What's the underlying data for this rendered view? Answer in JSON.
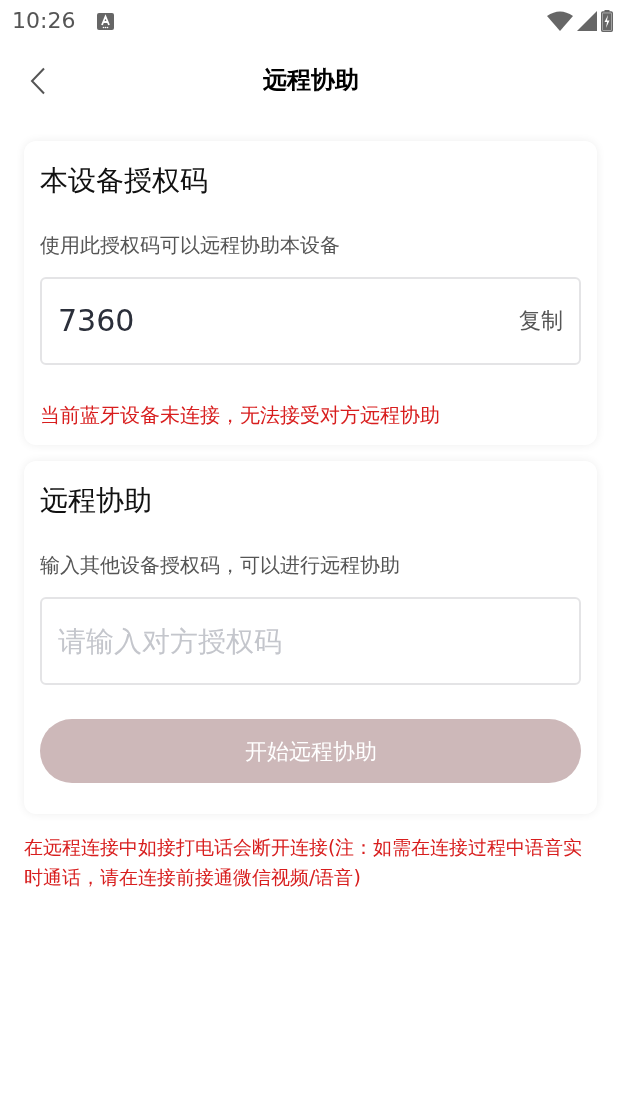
{
  "status_bar": {
    "time": "10:26"
  },
  "header": {
    "title": "远程协助"
  },
  "device_code_card": {
    "title": "本设备授权码",
    "subtitle": "使用此授权码可以远程协助本设备",
    "code": "7360",
    "copy_label": "复制",
    "warning": "当前蓝牙设备未连接，无法接受对方远程协助"
  },
  "remote_assist_card": {
    "title": "远程协助",
    "subtitle": "输入其他设备授权码，可以进行远程协助",
    "input": {
      "placeholder": "请输入对方授权码"
    },
    "button": {
      "label": "开始远程协助",
      "disabled": true
    }
  },
  "note": "在远程连接中如接打电话会断开连接(注：如需在连接过程中语音实时通话，请在连接前接通微信视频/语音)"
}
